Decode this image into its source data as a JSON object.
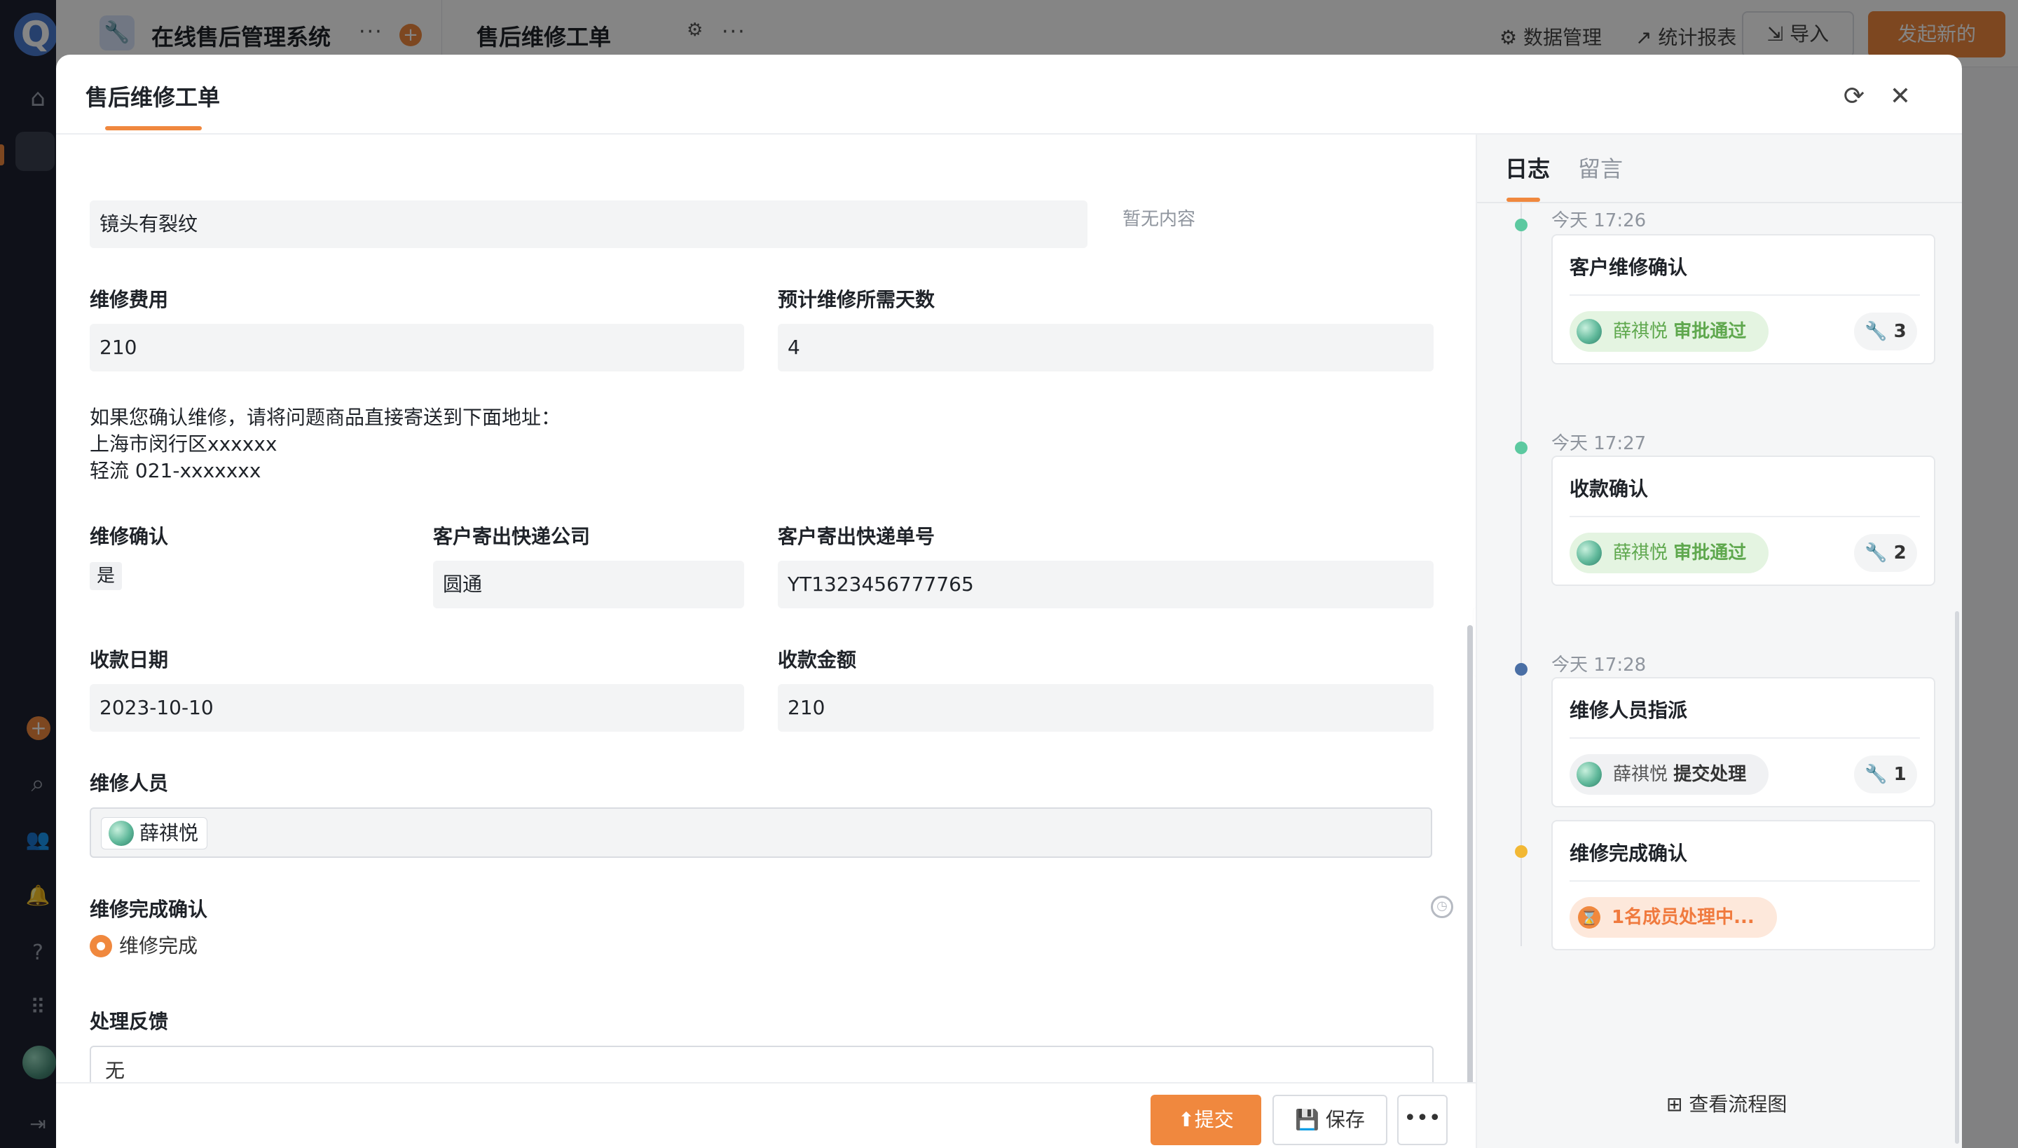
{
  "app": {
    "title": "在线售后管理系统",
    "page_title": "售后维修工单",
    "actions": {
      "data_manage": "数据管理",
      "report": "统计报表",
      "import": "导入",
      "new": "发起新的"
    }
  },
  "modal": {
    "tab": "售后维修工单",
    "form": {
      "issue_value": "镜头有裂纹",
      "empty_hint": "暂无内容",
      "fee_label": "维修费用",
      "fee_value": "210",
      "days_label": "预计维修所需天数",
      "days_value": "4",
      "note_lines": [
        "如果您确认维修，请将问题商品直接寄送到下面地址：",
        "上海市闵行区xxxxxx",
        "轻流 021-xxxxxxx"
      ],
      "confirm_label": "维修确认",
      "confirm_value": "是",
      "courier_label": "客户寄出快递公司",
      "courier_value": "圆通",
      "tracking_label": "客户寄出快递单号",
      "tracking_value": "YT1323456777765",
      "pay_date_label": "收款日期",
      "pay_date_value": "2023-10-10",
      "pay_amount_label": "收款金额",
      "pay_amount_value": "210",
      "staff_label": "维修人员",
      "staff_value": "薛祺悦",
      "done_label": "维修完成确认",
      "done_option": "维修完成",
      "feedback_label": "处理反馈",
      "feedback_value": "无"
    },
    "footer": {
      "submit": "提交",
      "save": "保存",
      "more": "•••"
    }
  },
  "side": {
    "tabs": [
      "日志",
      "留言"
    ],
    "entries": [
      {
        "time": "今天 17:26",
        "title": "客户维修确认",
        "user": "薛祺悦",
        "action": "审批通过",
        "count": "3",
        "dot": "#5cc9a0"
      },
      {
        "time": "今天 17:27",
        "title": "收款确认",
        "user": "薛祺悦",
        "action": "审批通过",
        "count": "2",
        "dot": "#5cc9a0"
      },
      {
        "time": "今天 17:28",
        "title": "维修人员指派",
        "user": "薛祺悦",
        "action": "提交处理",
        "count": "1",
        "dot": "#4a6fa5"
      },
      {
        "title": "维修完成确认",
        "status": "1名成员处理中...",
        "dot": "#f2b834"
      }
    ],
    "flow_link": "查看流程图"
  }
}
